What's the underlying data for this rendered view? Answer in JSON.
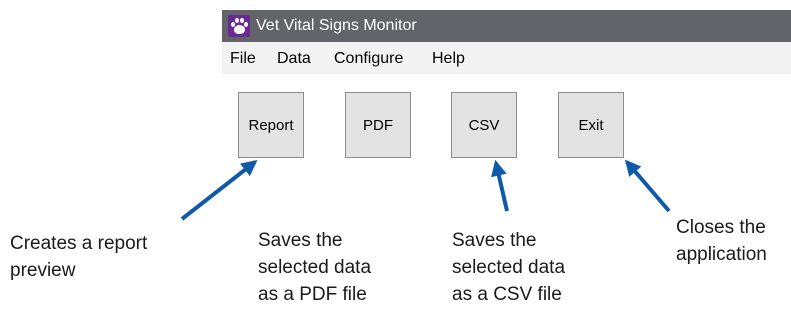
{
  "window": {
    "title": "Vet Vital Signs Monitor",
    "icon": "paw-icon"
  },
  "menu": {
    "items": [
      {
        "label": "File"
      },
      {
        "label": "Data"
      },
      {
        "label": "Configure"
      },
      {
        "label": "Help"
      }
    ]
  },
  "buttons": {
    "report": "Report",
    "pdf": "PDF",
    "csv": "CSV",
    "exit": "Exit"
  },
  "annotations": {
    "report": "Creates a report\npreview",
    "pdf": "Saves the\nselected data\nas a PDF file",
    "csv": "Saves the\nselected data\nas a CSV file",
    "exit": "Closes the\napplication"
  },
  "colors": {
    "titlebar": "#626469",
    "menubar": "#f3f3f3",
    "button_face": "#e3e3e3",
    "arrow": "#0f5aa8",
    "icon_bg": "#6a2a95"
  }
}
